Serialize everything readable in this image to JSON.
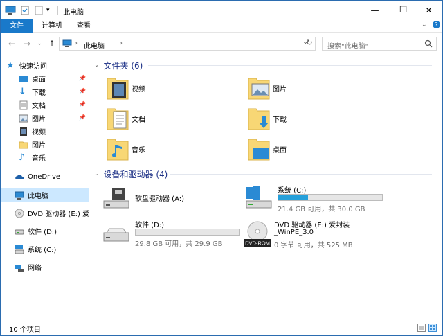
{
  "window": {
    "title": "此电脑",
    "minimize": "—",
    "maximize": "☐",
    "close": "✕"
  },
  "ribbon": {
    "tabs": [
      {
        "label": "文件"
      },
      {
        "label": "计算机"
      },
      {
        "label": "查看"
      }
    ]
  },
  "address": {
    "crumb_sep1": "›",
    "location": "此电脑",
    "crumb_sep2": "›",
    "dropdown": "⌄",
    "refresh": "↻",
    "search_placeholder": "搜索\"此电脑\""
  },
  "nav": {
    "back": "←",
    "forward": "→",
    "recent": "⌄",
    "up": "↑"
  },
  "sidebar": {
    "quick_access": "快速访问",
    "quick_items": [
      {
        "label": "桌面",
        "pinned": true
      },
      {
        "label": "下载",
        "pinned": true
      },
      {
        "label": "文档",
        "pinned": true
      },
      {
        "label": "图片",
        "pinned": true
      },
      {
        "label": "视频",
        "pinned": false
      },
      {
        "label": "图片",
        "pinned": false
      },
      {
        "label": "音乐",
        "pinned": false
      }
    ],
    "onedrive": "OneDrive",
    "this_pc": "此电脑",
    "drives": [
      {
        "label": "DVD 驱动器 (E:) 爱封"
      },
      {
        "label": "软件 (D:)"
      },
      {
        "label": "系统 (C:)"
      }
    ],
    "network": "网络",
    "pin_icon": "📌"
  },
  "folders_group": {
    "title": "文件夹 (6)",
    "items": [
      {
        "label": "视频"
      },
      {
        "label": "图片"
      },
      {
        "label": "文档"
      },
      {
        "label": "下载"
      },
      {
        "label": "音乐"
      },
      {
        "label": "桌面"
      }
    ]
  },
  "drives_group": {
    "title": "设备和驱动器 (4)",
    "items": [
      {
        "name": "软盘驱动器 (A:)"
      },
      {
        "name": "系统 (C:)",
        "used_fraction": 0.287,
        "info": "21.4 GB 可用，共 30.0 GB"
      },
      {
        "name": "软件 (D:)",
        "used_fraction": 0.003,
        "info": "29.8 GB 可用，共 29.9 GB"
      },
      {
        "name": "DVD 驱动器 (E:) 爱封装",
        "name2": "_WinPE_3.0",
        "info": "0 字节 可用，共 525 MB",
        "disc_label": "DVD-ROM"
      }
    ]
  },
  "status": {
    "items_count": "10 个项目"
  },
  "colors": {
    "accent": "#1979ca",
    "selection": "#cce8ff",
    "drive_bar": "#26a0da",
    "folder": "#f8d775"
  }
}
